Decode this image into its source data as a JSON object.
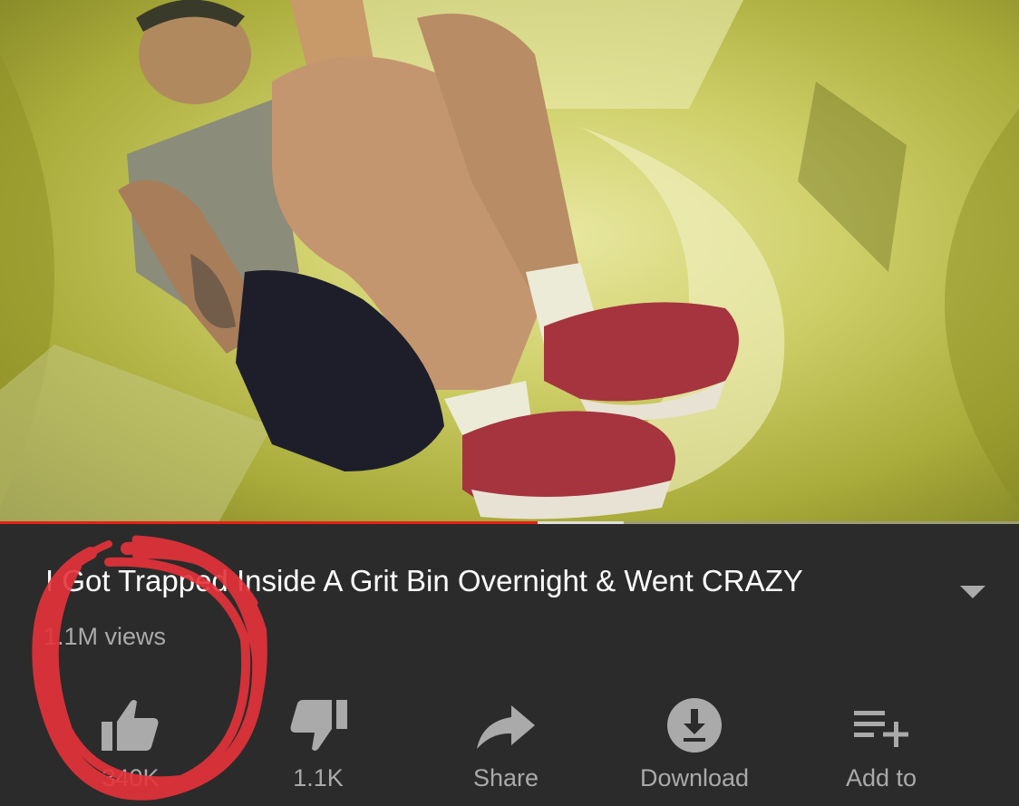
{
  "video": {
    "thumbnail_icon": "video-frame",
    "progress": {
      "played_fraction": 0.528,
      "buffered_fraction": 0.612
    }
  },
  "info": {
    "title": "I Got Trapped Inside A Grit Bin Overnight & Went CRAZY",
    "views": "1.1M views",
    "expand_icon": "chevron-down-icon"
  },
  "actions": [
    {
      "key": "like",
      "label": "340K",
      "icon": "thumbs-up-icon"
    },
    {
      "key": "dislike",
      "label": "1.1K",
      "icon": "thumbs-down-icon"
    },
    {
      "key": "share",
      "label": "Share",
      "icon": "share-arrow-icon"
    },
    {
      "key": "download",
      "label": "Download",
      "icon": "download-circle-icon"
    },
    {
      "key": "add-to",
      "label": "Add to",
      "icon": "playlist-add-icon"
    }
  ],
  "colors": {
    "background": "#2b2b2b",
    "title_text": "#ffffff",
    "secondary_text": "#aaaaaa",
    "icon": "#aaaaaa",
    "progress_played": "#e62117",
    "annotation_scribble": "#e8323a"
  }
}
